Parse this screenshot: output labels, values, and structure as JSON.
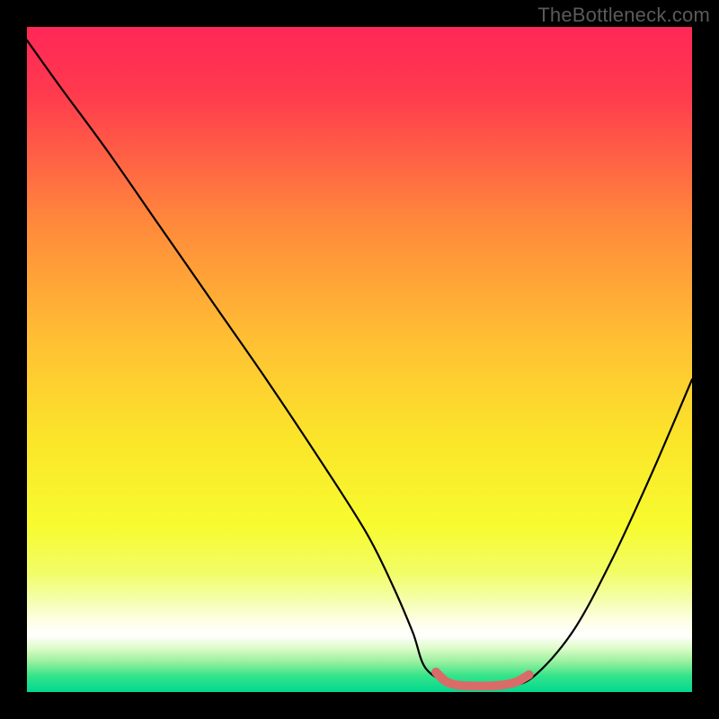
{
  "watermark": "TheBottleneck.com",
  "chart_data": {
    "type": "line",
    "title": "",
    "xlabel": "",
    "ylabel": "",
    "xlim": [
      0,
      100
    ],
    "ylim": [
      0,
      100
    ],
    "series": [
      {
        "name": "bottleneck-curve",
        "x": [
          0,
          5,
          12,
          20,
          28,
          36,
          44,
          51,
          55,
          58,
          60,
          64,
          68,
          72,
          76,
          82,
          88,
          94,
          100
        ],
        "y": [
          98,
          91,
          81.5,
          70,
          58.5,
          47,
          35,
          24,
          16,
          9,
          3.5,
          1.2,
          1.0,
          1.0,
          2.2,
          9,
          20,
          33,
          47
        ],
        "color": "#000000",
        "stroke_width": 2.2
      },
      {
        "name": "rounded-highlight",
        "x": [
          61.5,
          63,
          65,
          68,
          71,
          73.5,
          75.5
        ],
        "y": [
          3.0,
          1.6,
          1.0,
          0.9,
          1.0,
          1.5,
          2.6
        ],
        "color": "#D96C68",
        "stroke_width": 10,
        "linecap": "round"
      }
    ],
    "background_gradient": {
      "type": "vertical",
      "stops": [
        {
          "offset": 0.0,
          "color": "#FF2757"
        },
        {
          "offset": 0.1,
          "color": "#FF3A4E"
        },
        {
          "offset": 0.3,
          "color": "#FF8B3B"
        },
        {
          "offset": 0.48,
          "color": "#FFC233"
        },
        {
          "offset": 0.62,
          "color": "#FBE52A"
        },
        {
          "offset": 0.75,
          "color": "#F7FB2F"
        },
        {
          "offset": 0.82,
          "color": "#F2FD66"
        },
        {
          "offset": 0.86,
          "color": "#F5FEA9"
        },
        {
          "offset": 0.89,
          "color": "#FCFFE1"
        },
        {
          "offset": 0.915,
          "color": "#FFFFFF"
        },
        {
          "offset": 0.935,
          "color": "#DCFBC6"
        },
        {
          "offset": 0.955,
          "color": "#96F09E"
        },
        {
          "offset": 0.975,
          "color": "#37E48A"
        },
        {
          "offset": 1.0,
          "color": "#00D88F"
        }
      ]
    }
  }
}
